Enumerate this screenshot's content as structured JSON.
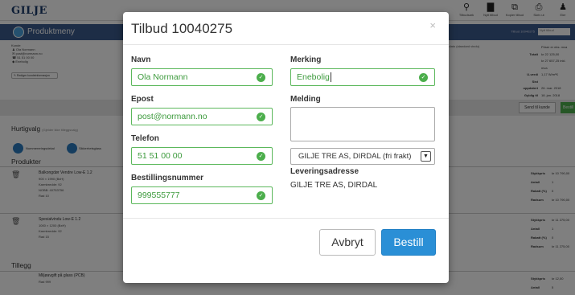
{
  "app": {
    "logo": "GILJE",
    "toolbar": [
      {
        "label": "Tilbudsark",
        "icon": "search-icon"
      },
      {
        "label": "Nytt tilbud",
        "icon": "document-icon"
      },
      {
        "label": "Kopier tilbud",
        "icon": "copy-icon"
      },
      {
        "label": "Skriv ut",
        "icon": "print-icon"
      },
      {
        "label": "Eier",
        "icon": "user-icon"
      }
    ],
    "product_menu": "Produktmeny",
    "product_menu_right": "Tilbud 10040275",
    "product_menu_field": "Nytt tilbud",
    "customer": {
      "heading": "Kunde",
      "lines": [
        "Ola Normann",
        "post@normann.no",
        "51 51 00 00",
        "Enebolig"
      ],
      "edit_button": "Rediger kundeinformasjon"
    },
    "price_note": "pr dagsdato (standard vindu)",
    "summary": [
      {
        "label": "",
        "value": "Priser er eks. mva"
      },
      {
        "label": "Totalt",
        "value": "kr 22 125,00"
      },
      {
        "label": "",
        "value": "kr 27 657,25 inkl. mva"
      },
      {
        "label": "U-verdi",
        "value": "1,17 W/m²K"
      },
      {
        "label": "Sist oppdatert",
        "value": "26. mar. 2018"
      },
      {
        "label": "Gyldig til",
        "value": "18. jan. 2018"
      },
      {
        "label": "Status",
        "value": "Ingen"
      }
    ],
    "send_button": "Send til kunde",
    "bestill_button": "Bestill",
    "hurtigvalg": {
      "title": "Hurtigvalg",
      "subtitle": "(Gjelder ikke tilleggsvalg)"
    },
    "hurtigvalg_items": [
      "Nummereringsdekal",
      "Sikkerhetsglass"
    ],
    "products_heading": "Produkter",
    "products": [
      {
        "name": "Balkongdør Vendre Low-E 1.2",
        "lines": [
          "900 × 1990 (BxH)",
          "Karmbredde: 92",
          "NOBB: 40753756",
          "Rad 10"
        ],
        "right": [
          [
            "Stykkpris",
            "kr 10 790,00"
          ],
          [
            "Antall",
            "1"
          ],
          [
            "Rabatt (%)",
            "0"
          ],
          [
            "Radsum",
            "kr 10 790,00"
          ]
        ]
      },
      {
        "name": "Spesialvindu Low-E 1.2",
        "lines": [
          "1000 × 1200 (BxH)",
          "Karmbredde: 92",
          "Rad 15"
        ],
        "right": [
          [
            "Stykkpris",
            "kr 11 275,00"
          ],
          [
            "Antall",
            "1"
          ],
          [
            "Rabatt (%)",
            "0"
          ],
          [
            "Radsum",
            "kr 11 275,00"
          ]
        ]
      }
    ],
    "tillegg_heading": "Tillegg",
    "tillegg": {
      "name": "Miljøavgift på glass (PCB)",
      "lines": [
        "Rad 999"
      ],
      "right": [
        [
          "Stykkpris",
          "kr 12,00"
        ],
        [
          "Antall",
          "5"
        ]
      ]
    }
  },
  "modal": {
    "title": "Tilbud 10040275",
    "close": "×",
    "fields": {
      "navn": {
        "label": "Navn",
        "value": "Ola Normann"
      },
      "epost": {
        "label": "Epost",
        "value": "post@normann.no"
      },
      "telefon": {
        "label": "Telefon",
        "value": "51 51 00 00"
      },
      "bestillingsnummer": {
        "label": "Bestillingsnummer",
        "value": "999555777"
      },
      "merking": {
        "label": "Merking",
        "value": "Enebolig"
      },
      "melding": {
        "label": "Melding",
        "value": ""
      }
    },
    "supplier_select": "GILJE TRE AS, DIRDAL (fri frakt)",
    "leveringsadresse_label": "Leveringsadresse",
    "leveringsadresse_value": "GILJE TRE AS, DIRDAL",
    "cancel_button": "Avbryt",
    "submit_button": "Bestill"
  },
  "colors": {
    "valid": "#5cb85c",
    "primary": "#2a8fd6",
    "header": "#3a5a8c"
  }
}
